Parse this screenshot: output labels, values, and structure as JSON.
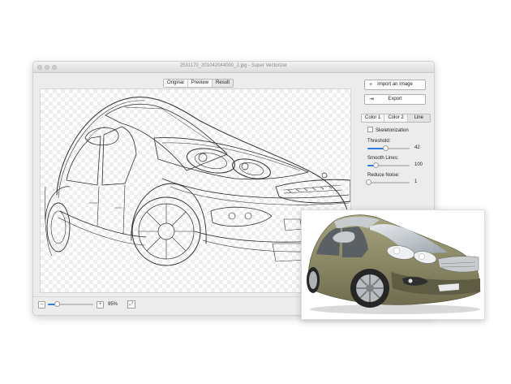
{
  "window": {
    "title": "2531170_201042044000_2.jpg - Super Vectorizer",
    "view_tabs": [
      "Original",
      "Preview",
      "Result"
    ],
    "active_view": "Result",
    "zoom_label": "95%",
    "zoom_level": 0.2
  },
  "panel": {
    "import_button": "Import an Image",
    "export_button": "Export",
    "mode_tabs": [
      "Color 1",
      "Color 2",
      "Line"
    ],
    "active_mode": "Line",
    "skeletonization_label": "Skeletonization",
    "skeletonization_checked": false,
    "threshold": {
      "label": "Threshold:",
      "value": "42",
      "level": 0.42
    },
    "smooth_lines": {
      "label": "Smooth Lines:",
      "value": "100",
      "level": 0.2
    },
    "reduce_noise": {
      "label": "Reduce Noise:",
      "value": "1",
      "level": 0.02
    }
  },
  "colors": {
    "accent": "#2b7be4",
    "car_body": "#8c8a66",
    "line_art": "#2e2e2e"
  }
}
